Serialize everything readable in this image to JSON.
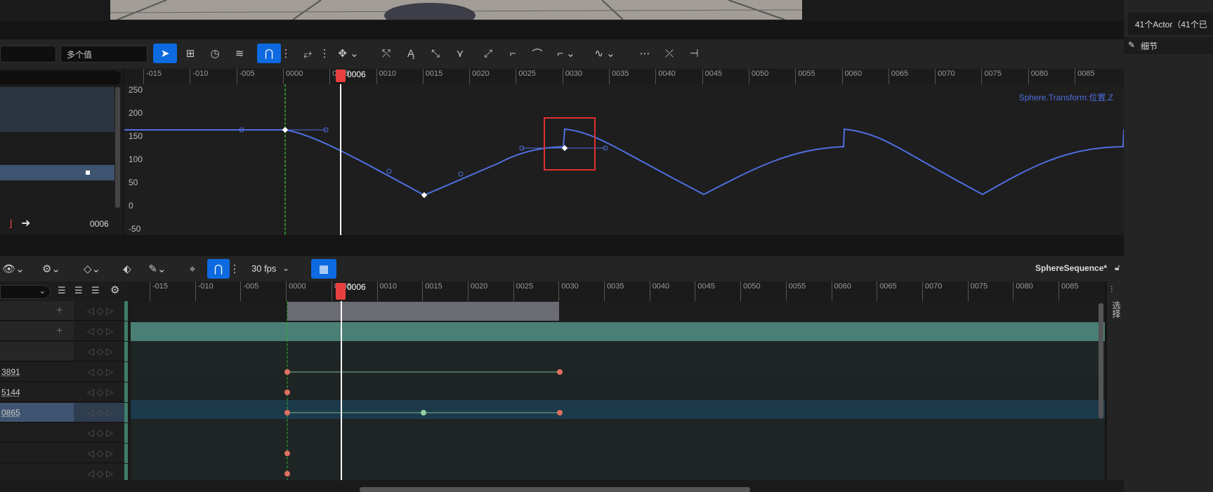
{
  "viewport": {
    "actor_count": "41个Actor（41个已"
  },
  "details": {
    "label": "细节"
  },
  "curve_editor": {
    "multi_value": "多个值",
    "frame_value": "0006",
    "playhead_label": "0006",
    "curve_name": "Sphere.Transform.位置.Z",
    "ticks": [
      "-015",
      "-010",
      "-005",
      "0000",
      "0005",
      "0010",
      "0015",
      "0020",
      "0025",
      "0030",
      "0035",
      "0040",
      "0045",
      "0050",
      "0055",
      "0060",
      "0065",
      "0070",
      "0075",
      "0080",
      "0085"
    ],
    "y_labels": [
      "250",
      "200",
      "150",
      "100",
      "50",
      "0",
      "-50"
    ]
  },
  "sequencer": {
    "fps": "30 fps",
    "sequence_name": "SphereSequence*",
    "playhead_label": "0006",
    "ticks": [
      "-015",
      "-010",
      "-005",
      "0000",
      "0005",
      "0010",
      "0015",
      "0020",
      "0025",
      "0030",
      "0035",
      "0040",
      "0045",
      "0050",
      "0055",
      "0060",
      "0065",
      "0070",
      "0075",
      "0080",
      "0085"
    ],
    "track_values": [
      "3891",
      "5144",
      "0865"
    ],
    "side_tab": "选择"
  },
  "colors": {
    "accent": "#0e6ae0",
    "curve": "#4f6fe0",
    "playhead": "#e84040",
    "key": "#e07060"
  }
}
